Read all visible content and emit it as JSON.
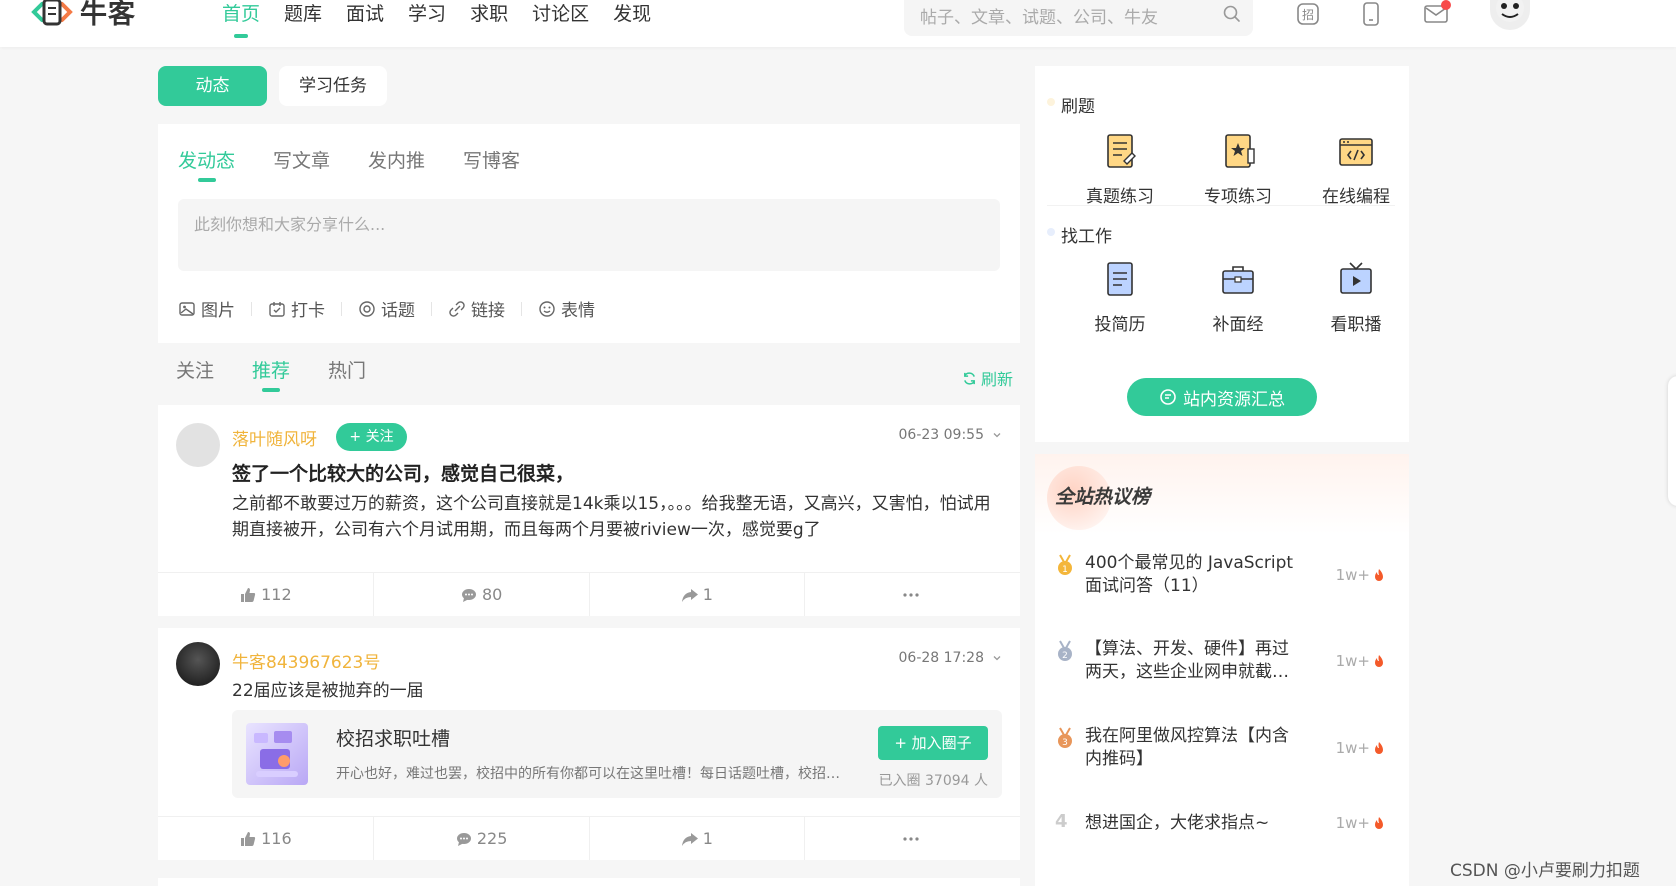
{
  "brand": {
    "name": "牛客",
    "accent": "#32ca99"
  },
  "nav": {
    "items": [
      "首页",
      "题库",
      "面试",
      "学习",
      "求职",
      "讨论区",
      "发现"
    ],
    "active": 0
  },
  "search": {
    "placeholder": "帖子、文章、试题、公司、牛友"
  },
  "topIcons": [
    "zhao-icon",
    "phone-icon",
    "mail-icon"
  ],
  "leftTabs": {
    "active": "动态",
    "other": "学习任务"
  },
  "compose": {
    "tabs": [
      "发动态",
      "写文章",
      "发内推",
      "写博客"
    ],
    "placeholder": "此刻你想和大家分享什么...",
    "tools": [
      "图片",
      "打卡",
      "话题",
      "链接",
      "表情"
    ]
  },
  "feed": {
    "tabs": [
      "关注",
      "推荐",
      "热门"
    ],
    "refresh": "刷新"
  },
  "posts": [
    {
      "author": "落叶随风呀",
      "follow": "+ 关注",
      "time": "06-23 09:55",
      "title": "签了一个比较大的公司，感觉自己很菜，",
      "body": "之前都不敢要过万的薪资，这个公司直接就是14k乘以15，。。。给我整无语，又高兴，又害怕，怕试用期直接被开，公司有六个月试用期，而且每两个月要被riview一次，感觉要g了",
      "likes": "112",
      "comments": "80",
      "shares": "1"
    },
    {
      "author": "牛客843967623号",
      "time": "06-28 17:28",
      "body": "22届应该是被抛弃的一届",
      "circle": {
        "name": "校招求职吐槽",
        "desc": "开心也好，难过也罢，校招中的所有你都可以在这里吐槽！每日话题吐槽，校招中你遇到过哪些奇葩的事情",
        "join": "+ 加入圈子",
        "joined": "已入圈 37094 人"
      },
      "likes": "116",
      "comments": "225",
      "shares": "1"
    }
  ],
  "sidebar": {
    "practice": {
      "title": "刷题",
      "items": [
        "真题练习",
        "专项练习",
        "在线编程"
      ]
    },
    "jobs": {
      "title": "找工作",
      "items": [
        "投简历",
        "补面经",
        "看职播"
      ]
    },
    "resourceButton": "站内资源汇总"
  },
  "hot": {
    "title": "全站热议榜",
    "items": [
      {
        "rank": "1",
        "text": "400个最常见的 JavaScript 面试问答（11）",
        "count": "1w+"
      },
      {
        "rank": "2",
        "text": "【算法、开发、硬件】再过两天，这些企业网申就截…",
        "count": "1w+"
      },
      {
        "rank": "3",
        "text": "我在阿里做风控算法【内含内推码】",
        "count": "1w+"
      },
      {
        "rank": "4",
        "text": "想进国企，大佬求指点~",
        "count": "1w+"
      }
    ]
  },
  "watermark": "CSDN @小卢要刷力扣题"
}
